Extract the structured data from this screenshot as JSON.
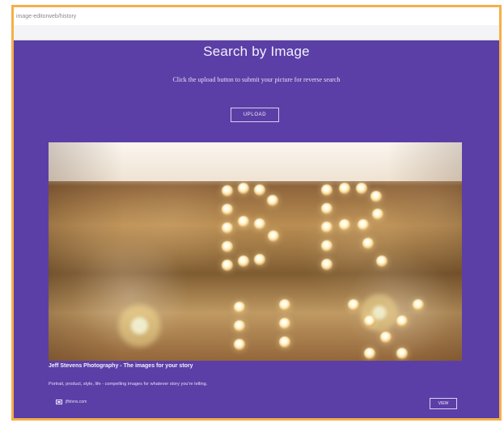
{
  "address_bar": {
    "text": "image-editorweb/history"
  },
  "page": {
    "title": "Search by Image",
    "subtitle": "Click the upload button to submit your picture for reverse search",
    "upload_label": "UPLOAD"
  },
  "result_card": {
    "title": "Jeff Stevens Photography - The images for your story",
    "description": "Portrait, product, style, life - compelling images for whatever story you're telling.",
    "source": "jffstvns.com",
    "button_label": "VIEW"
  },
  "colors": {
    "frame_border": "#f4b04a",
    "page_background": "#5b3fa6",
    "text_light": "#f3efff"
  }
}
